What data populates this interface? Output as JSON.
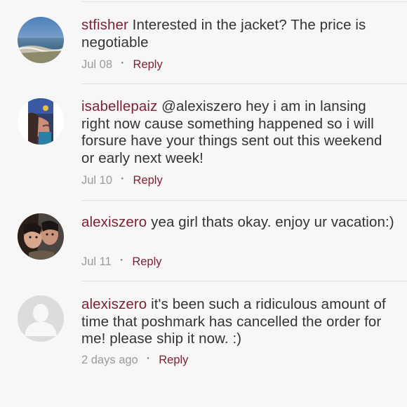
{
  "comments": [
    {
      "username": "stfisher",
      "text": "Interested in the jacket? The price is negotiable",
      "date": "Jul 08",
      "separator": "·",
      "reply_label": "Reply"
    },
    {
      "username": "isabellepaiz",
      "text": "@alexiszero hey i am in lansing right now cause something happened so i will forsure have your things sent out this weekend or early next week!",
      "date": "Jul 10",
      "separator": "·",
      "reply_label": "Reply"
    },
    {
      "username": "alexiszero",
      "text": "yea girl thats okay. enjoy ur vacation:)",
      "date": "Jul 11",
      "separator": "·",
      "reply_label": "Reply"
    },
    {
      "username": "alexiszero",
      "text": "it's been such a ridiculous amount of time that poshmark has cancelled the order for me! please ship it now. :)",
      "date": "2 days ago",
      "separator": "·",
      "reply_label": "Reply"
    }
  ],
  "colors": {
    "username": "#7c2235",
    "body_text": "#333333",
    "meta_text": "#9a9a9a",
    "background": "#f7f7f7"
  },
  "avatars": [
    "beach-photo-avatar",
    "selfie-photo-avatar",
    "couple-photo-avatar",
    "default-user-icon"
  ]
}
